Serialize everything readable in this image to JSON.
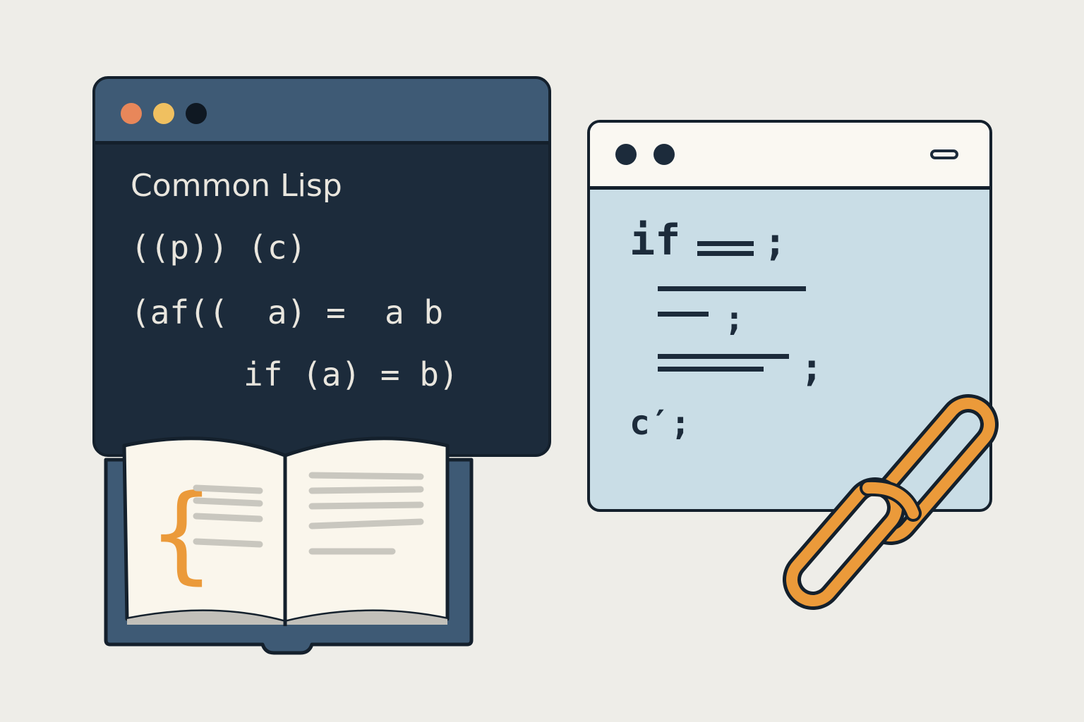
{
  "colors": {
    "background": "#eeede8",
    "dark_window": "#1c2b3b",
    "dark_titlebar": "#3e5a75",
    "light_window": "#c9dde6",
    "light_titlebar": "#faf8f2",
    "accent_orange": "#eb9a3a",
    "dot_orange": "#e8875a",
    "dot_yellow": "#f0c060",
    "book_page": "#faf6ec"
  },
  "left_window": {
    "title": "Common Lisp",
    "code_lines": [
      "((p)) (c)",
      "(af((  a) =  a b",
      "if (a) = b)"
    ]
  },
  "book": {
    "brace": "{",
    "icon": "open-book-icon"
  },
  "right_window": {
    "line1_keyword": "if",
    "line1_end": ";",
    "line3_end": ";",
    "line4_end": ";",
    "line5": "c′;"
  },
  "link_icon": "chain-link-icon"
}
